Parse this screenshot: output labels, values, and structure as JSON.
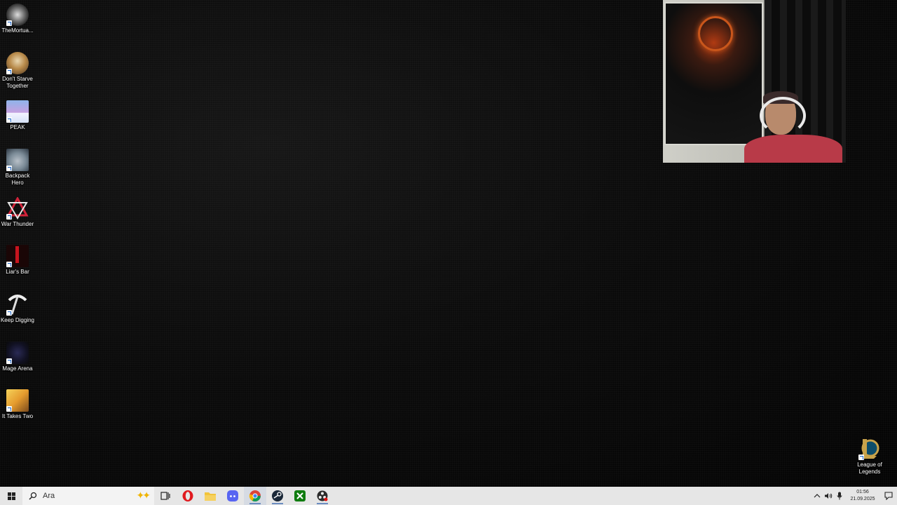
{
  "desktop": {
    "icons": [
      {
        "label": "TheMortua...",
        "icon": "themortuary-icon"
      },
      {
        "label": "Don't Starve Together",
        "icon": "dont-starve-icon"
      },
      {
        "label": "PEAK",
        "icon": "peak-icon"
      },
      {
        "label": "Backpack Hero",
        "icon": "backpack-hero-icon"
      },
      {
        "label": "War Thunder",
        "icon": "war-thunder-icon"
      },
      {
        "label": "Liar's Bar",
        "icon": "liars-bar-icon"
      },
      {
        "label": "Keep Digging",
        "icon": "keep-digging-icon"
      },
      {
        "label": "Mage Arena",
        "icon": "mage-arena-icon"
      },
      {
        "label": "It Takes Two",
        "icon": "it-takes-two-icon"
      },
      {
        "label": "League of Legends",
        "icon": "league-of-legends-icon"
      }
    ]
  },
  "taskbar": {
    "search_placeholder": "Ara",
    "apps": [
      "task-view-icon",
      "opera-icon",
      "file-explorer-icon",
      "discord-icon",
      "chrome-icon",
      "steam-icon",
      "xbox-icon",
      "obs-icon"
    ],
    "clock": {
      "time": "01:56",
      "date": "21.09.2025"
    }
  },
  "colors": {
    "taskbar_bg": "#e6e6e6",
    "desktop_bg": "#060606"
  }
}
